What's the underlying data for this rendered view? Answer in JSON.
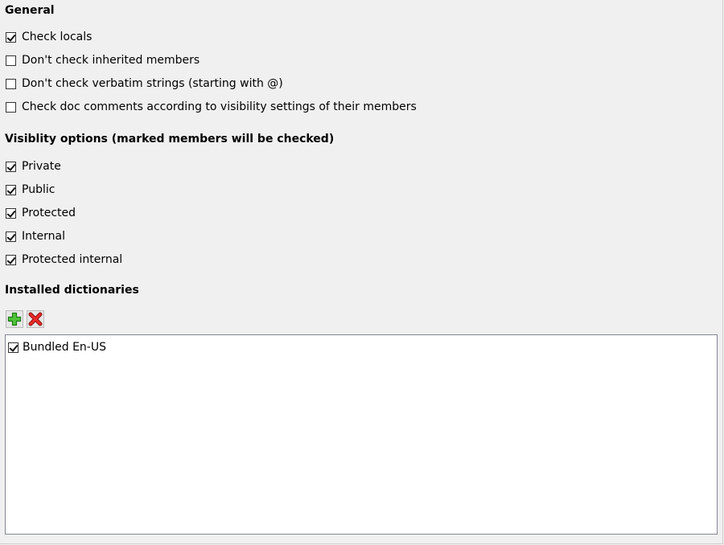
{
  "general": {
    "heading": "General",
    "options": [
      {
        "label": "Check locals",
        "checked": true
      },
      {
        "label": "Don't check inherited members",
        "checked": false
      },
      {
        "label": "Don't check verbatim strings (starting with @)",
        "checked": false
      },
      {
        "label": "Check doc comments according to visibility settings of their members",
        "checked": false
      }
    ]
  },
  "visibility": {
    "heading": "Visiblity options (marked members will be checked)",
    "options": [
      {
        "label": "Private",
        "checked": true
      },
      {
        "label": "Public",
        "checked": true
      },
      {
        "label": "Protected",
        "checked": true
      },
      {
        "label": "Internal",
        "checked": true
      },
      {
        "label": "Protected internal",
        "checked": true
      }
    ]
  },
  "dictionaries": {
    "heading": "Installed dictionaries",
    "toolbar": {
      "add_icon": "add-icon",
      "remove_icon": "remove-icon",
      "add_color": "#2e9e1f",
      "remove_color": "#e01e1e"
    },
    "items": [
      {
        "label": "Bundled En-US",
        "checked": true
      }
    ]
  }
}
